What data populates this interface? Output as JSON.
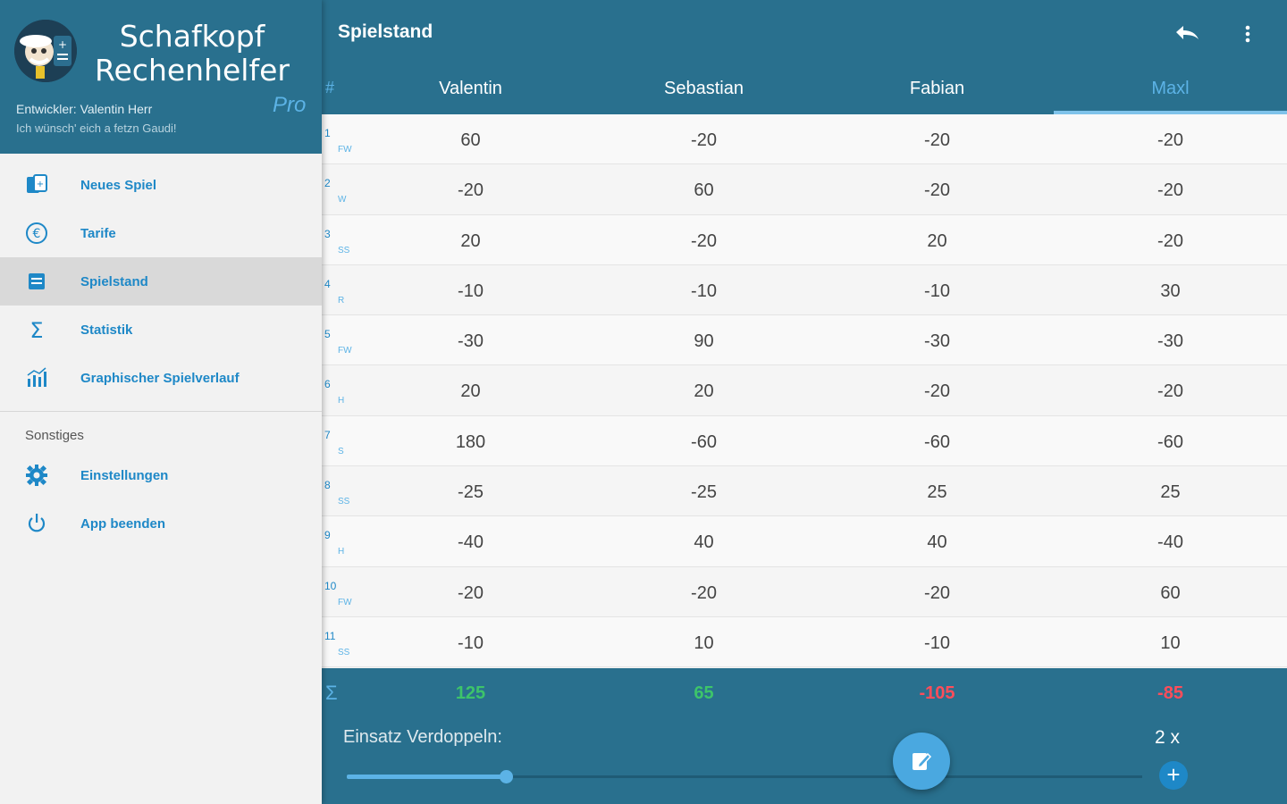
{
  "drawer": {
    "title_line1": "Schafkopf",
    "title_line2": "Rechenhelfer",
    "badge": "Pro",
    "developer": "Entwickler: Valentin Herr",
    "motto": "Ich wünsch' eich a fetzn Gaudi!",
    "items": [
      {
        "label": "Neues Spiel",
        "icon": "new-game-icon"
      },
      {
        "label": "Tarife",
        "icon": "euro-icon"
      },
      {
        "label": "Spielstand",
        "icon": "scoreboard-icon",
        "active": true
      },
      {
        "label": "Statistik",
        "icon": "sigma-icon"
      },
      {
        "label": "Graphischer Spielverlauf",
        "icon": "chart-icon"
      }
    ],
    "section": "Sonstiges",
    "other_items": [
      {
        "label": "Einstellungen",
        "icon": "gear-icon"
      },
      {
        "label": "App beenden",
        "icon": "power-icon"
      }
    ]
  },
  "appbar": {
    "title": "Spielstand"
  },
  "table": {
    "hash": "#",
    "players": [
      "Valentin",
      "Sebastian",
      "Fabian",
      "Maxl"
    ],
    "rows": [
      {
        "n": "1",
        "type": "FW",
        "v": [
          "60",
          "-20",
          "-20",
          "-20"
        ]
      },
      {
        "n": "2",
        "type": "W",
        "v": [
          "-20",
          "60",
          "-20",
          "-20"
        ]
      },
      {
        "n": "3",
        "type": "SS",
        "v": [
          "20",
          "-20",
          "20",
          "-20"
        ]
      },
      {
        "n": "4",
        "type": "R",
        "v": [
          "-10",
          "-10",
          "-10",
          "30"
        ]
      },
      {
        "n": "5",
        "type": "FW",
        "v": [
          "-30",
          "90",
          "-30",
          "-30"
        ]
      },
      {
        "n": "6",
        "type": "H",
        "v": [
          "20",
          "20",
          "-20",
          "-20"
        ]
      },
      {
        "n": "7",
        "type": "S",
        "v": [
          "180",
          "-60",
          "-60",
          "-60"
        ]
      },
      {
        "n": "8",
        "type": "SS",
        "v": [
          "-25",
          "-25",
          "25",
          "25"
        ]
      },
      {
        "n": "9",
        "type": "H",
        "v": [
          "-40",
          "40",
          "40",
          "-40"
        ]
      },
      {
        "n": "10",
        "type": "FW",
        "v": [
          "-20",
          "-20",
          "-20",
          "60"
        ]
      },
      {
        "n": "11",
        "type": "SS",
        "v": [
          "-10",
          "10",
          "-10",
          "10"
        ]
      }
    ],
    "sum_symbol": "Σ",
    "sums": [
      "125",
      "65",
      "-105",
      "-85"
    ]
  },
  "footer": {
    "einsatz_label": "Einsatz Verdoppeln:",
    "multiplier": "2 x",
    "slider_level": 0.2,
    "plus": "+"
  },
  "colors": {
    "primary": "#29708e",
    "accent": "#5cb3e6",
    "positive": "#3dc46a",
    "negative": "#ff4d5a"
  }
}
